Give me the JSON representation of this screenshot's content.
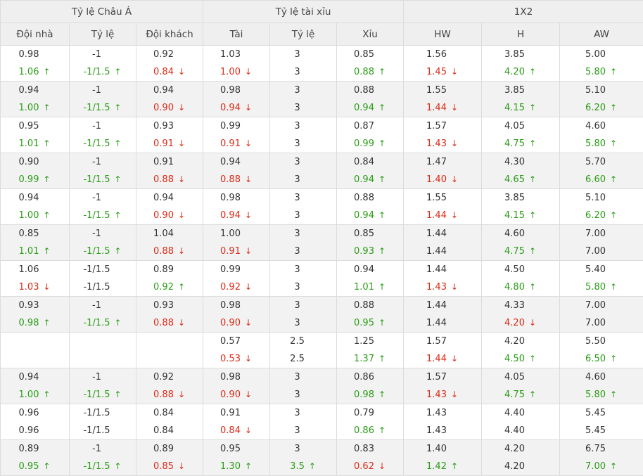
{
  "header": {
    "groups": [
      "Tỷ lệ Châu Á",
      "Tỷ lệ tài xỉu",
      "1X2"
    ],
    "columns": [
      "Đội nhà",
      "Tỷ lệ",
      "Đội khách",
      "Tài",
      "Tỷ lệ",
      "Xỉu",
      "HW",
      "H",
      "AW"
    ]
  },
  "colors": {
    "up": "#2a9d16",
    "down": "#dc2b17",
    "header_bg": "#efefef",
    "alt_row_bg": "#f2f2f2"
  },
  "rows": [
    {
      "top": [
        "0.98",
        "-1",
        "0.92",
        "1.03",
        "3",
        "0.85",
        "1.56",
        "3.85",
        "5.00"
      ],
      "bottom": [
        [
          "1.06",
          "up"
        ],
        [
          "-1/1.5",
          "up"
        ],
        [
          "0.84",
          "down"
        ],
        [
          "1.00",
          "down"
        ],
        [
          "3",
          ""
        ],
        [
          "0.88",
          "up"
        ],
        [
          "1.45",
          "down"
        ],
        [
          "4.20",
          "up"
        ],
        [
          "5.80",
          "up"
        ]
      ]
    },
    {
      "top": [
        "0.94",
        "-1",
        "0.94",
        "0.98",
        "3",
        "0.88",
        "1.55",
        "3.85",
        "5.10"
      ],
      "bottom": [
        [
          "1.00",
          "up"
        ],
        [
          "-1/1.5",
          "up"
        ],
        [
          "0.90",
          "down"
        ],
        [
          "0.94",
          "down"
        ],
        [
          "3",
          ""
        ],
        [
          "0.94",
          "up"
        ],
        [
          "1.44",
          "down"
        ],
        [
          "4.15",
          "up"
        ],
        [
          "6.20",
          "up"
        ]
      ]
    },
    {
      "top": [
        "0.95",
        "-1",
        "0.93",
        "0.99",
        "3",
        "0.87",
        "1.57",
        "4.05",
        "4.60"
      ],
      "bottom": [
        [
          "1.01",
          "up"
        ],
        [
          "-1/1.5",
          "up"
        ],
        [
          "0.91",
          "down"
        ],
        [
          "0.91",
          "down"
        ],
        [
          "3",
          ""
        ],
        [
          "0.99",
          "up"
        ],
        [
          "1.43",
          "down"
        ],
        [
          "4.75",
          "up"
        ],
        [
          "5.80",
          "up"
        ]
      ]
    },
    {
      "top": [
        "0.90",
        "-1",
        "0.91",
        "0.94",
        "3",
        "0.84",
        "1.47",
        "4.30",
        "5.70"
      ],
      "bottom": [
        [
          "0.99",
          "up"
        ],
        [
          "-1/1.5",
          "up"
        ],
        [
          "0.88",
          "down"
        ],
        [
          "0.88",
          "down"
        ],
        [
          "3",
          ""
        ],
        [
          "0.94",
          "up"
        ],
        [
          "1.40",
          "down"
        ],
        [
          "4.65",
          "up"
        ],
        [
          "6.60",
          "up"
        ]
      ]
    },
    {
      "top": [
        "0.94",
        "-1",
        "0.94",
        "0.98",
        "3",
        "0.88",
        "1.55",
        "3.85",
        "5.10"
      ],
      "bottom": [
        [
          "1.00",
          "up"
        ],
        [
          "-1/1.5",
          "up"
        ],
        [
          "0.90",
          "down"
        ],
        [
          "0.94",
          "down"
        ],
        [
          "3",
          ""
        ],
        [
          "0.94",
          "up"
        ],
        [
          "1.44",
          "down"
        ],
        [
          "4.15",
          "up"
        ],
        [
          "6.20",
          "up"
        ]
      ]
    },
    {
      "top": [
        "0.85",
        "-1",
        "1.04",
        "1.00",
        "3",
        "0.85",
        "1.44",
        "4.60",
        "7.00"
      ],
      "bottom": [
        [
          "1.01",
          "up"
        ],
        [
          "-1/1.5",
          "up"
        ],
        [
          "0.88",
          "down"
        ],
        [
          "0.91",
          "down"
        ],
        [
          "3",
          ""
        ],
        [
          "0.93",
          "up"
        ],
        [
          "1.44",
          ""
        ],
        [
          "4.75",
          "up"
        ],
        [
          "7.00",
          ""
        ]
      ]
    },
    {
      "top": [
        "1.06",
        "-1/1.5",
        "0.89",
        "0.99",
        "3",
        "0.94",
        "1.44",
        "4.50",
        "5.40"
      ],
      "bottom": [
        [
          "1.03",
          "down"
        ],
        [
          "-1/1.5",
          ""
        ],
        [
          "0.92",
          "up"
        ],
        [
          "0.92",
          "down"
        ],
        [
          "3",
          ""
        ],
        [
          "1.01",
          "up"
        ],
        [
          "1.43",
          "down"
        ],
        [
          "4.80",
          "up"
        ],
        [
          "5.80",
          "up"
        ]
      ]
    },
    {
      "top": [
        "0.93",
        "-1",
        "0.93",
        "0.98",
        "3",
        "0.88",
        "1.44",
        "4.33",
        "7.00"
      ],
      "bottom": [
        [
          "0.98",
          "up"
        ],
        [
          "-1/1.5",
          "up"
        ],
        [
          "0.88",
          "down"
        ],
        [
          "0.90",
          "down"
        ],
        [
          "3",
          ""
        ],
        [
          "0.95",
          "up"
        ],
        [
          "1.44",
          ""
        ],
        [
          "4.20",
          "down"
        ],
        [
          "7.00",
          ""
        ]
      ]
    },
    {
      "top": [
        "",
        "",
        "",
        "0.57",
        "2.5",
        "1.25",
        "1.57",
        "4.20",
        "5.50"
      ],
      "bottom": [
        [
          "",
          ""
        ],
        [
          "",
          ""
        ],
        [
          "",
          ""
        ],
        [
          "0.53",
          "down"
        ],
        [
          "2.5",
          ""
        ],
        [
          "1.37",
          "up"
        ],
        [
          "1.44",
          "down"
        ],
        [
          "4.50",
          "up"
        ],
        [
          "6.50",
          "up"
        ]
      ]
    },
    {
      "top": [
        "0.94",
        "-1",
        "0.92",
        "0.98",
        "3",
        "0.86",
        "1.57",
        "4.05",
        "4.60"
      ],
      "bottom": [
        [
          "1.00",
          "up"
        ],
        [
          "-1/1.5",
          "up"
        ],
        [
          "0.88",
          "down"
        ],
        [
          "0.90",
          "down"
        ],
        [
          "3",
          ""
        ],
        [
          "0.98",
          "up"
        ],
        [
          "1.43",
          "down"
        ],
        [
          "4.75",
          "up"
        ],
        [
          "5.80",
          "up"
        ]
      ]
    },
    {
      "top": [
        "0.96",
        "-1/1.5",
        "0.84",
        "0.91",
        "3",
        "0.79",
        "1.43",
        "4.40",
        "5.45"
      ],
      "bottom": [
        [
          "0.96",
          ""
        ],
        [
          "-1/1.5",
          ""
        ],
        [
          "0.84",
          ""
        ],
        [
          "0.84",
          "down"
        ],
        [
          "3",
          ""
        ],
        [
          "0.86",
          "up"
        ],
        [
          "1.43",
          ""
        ],
        [
          "4.40",
          ""
        ],
        [
          "5.45",
          ""
        ]
      ]
    },
    {
      "top": [
        "0.89",
        "-1",
        "0.89",
        "0.95",
        "3",
        "0.83",
        "1.40",
        "4.20",
        "6.75"
      ],
      "bottom": [
        [
          "0.95",
          "up"
        ],
        [
          "-1/1.5",
          "up"
        ],
        [
          "0.85",
          "down"
        ],
        [
          "1.30",
          "up"
        ],
        [
          "3.5",
          "up"
        ],
        [
          "0.62",
          "down"
        ],
        [
          "1.42",
          "up"
        ],
        [
          "4.20",
          ""
        ],
        [
          "7.00",
          "up"
        ]
      ]
    }
  ]
}
